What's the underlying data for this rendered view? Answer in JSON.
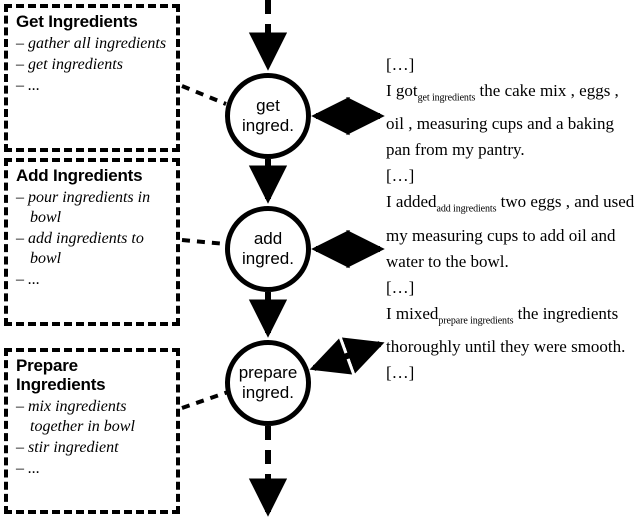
{
  "diagram": {
    "schema_boxes": [
      {
        "id": "get",
        "title": "Get Ingredients",
        "items": [
          "– gather all ingredients",
          "– get ingredients",
          "– ..."
        ]
      },
      {
        "id": "add",
        "title": "Add Ingredients",
        "items": [
          "– pour ingredients in bowl",
          "– add ingredients to bowl",
          "– ..."
        ]
      },
      {
        "id": "prepare",
        "title": "Prepare Ingredients",
        "items": [
          "– mix ingredients together in bowl",
          "– stir ingredient",
          "– ..."
        ]
      }
    ],
    "nodes": [
      {
        "id": "get",
        "line1": "get",
        "line2": "ingred."
      },
      {
        "id": "add",
        "line1": "add",
        "line2": "ingred."
      },
      {
        "id": "prepare",
        "line1": "prepare",
        "line2": "ingred."
      }
    ],
    "text_blocks": [
      {
        "id": "get",
        "top_ellipsis": "[…]",
        "before": "I got",
        "subscript": "get ingredients",
        "after": " the cake mix , eggs , oil , measuring cups and a baking pan from my pantry.",
        "bottom_ellipsis": "[…]"
      },
      {
        "id": "add",
        "top_ellipsis": "",
        "before": "I added",
        "subscript": "add ingredients",
        "after": " two eggs , and used my measuring cups to add oil and water to the bowl.",
        "bottom_ellipsis": "[…]"
      },
      {
        "id": "prepare",
        "top_ellipsis": "",
        "before": "I mixed",
        "subscript": "prepare ingredients",
        "after": " the ingredients thoroughly until they were smooth.",
        "bottom_ellipsis": "[…]"
      }
    ],
    "colors": {
      "stroke": "#000000",
      "background": "#ffffff"
    }
  }
}
